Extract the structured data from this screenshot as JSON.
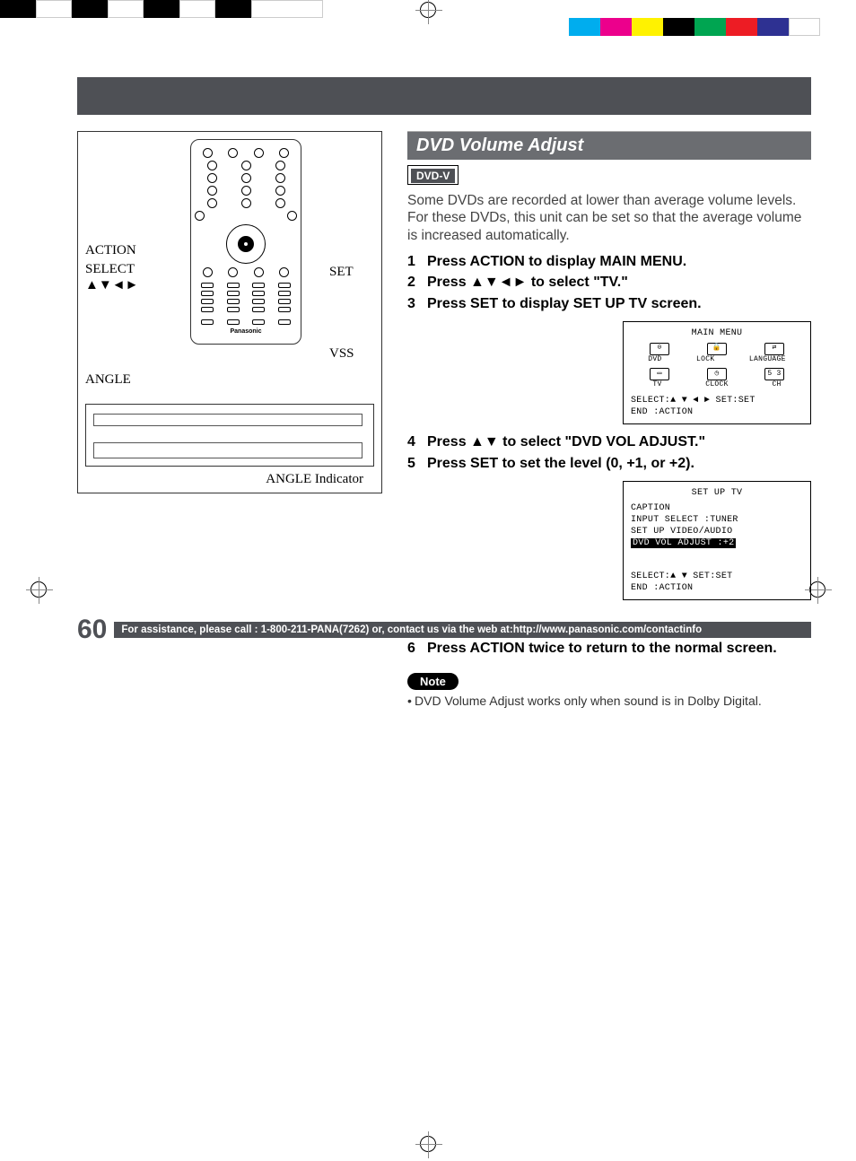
{
  "remote_labels": {
    "action": "ACTION",
    "select": "SELECT",
    "arrows": "▲▼◄►",
    "angle": "ANGLE",
    "set": "SET",
    "vss": "VSS",
    "angle_indicator": "ANGLE Indicator",
    "brand": "Panasonic"
  },
  "heading": "DVD Volume Adjust",
  "dvd_v": "DVD-V",
  "intro": "Some DVDs are recorded at lower than average volume levels. For these DVDs, this unit can be set so that the average volume is increased automatically.",
  "steps": {
    "s1": {
      "n": "1",
      "t": "Press ACTION to display MAIN MENU."
    },
    "s2": {
      "n": "2",
      "t": "Press ▲▼◄► to select \"TV.\""
    },
    "s3": {
      "n": "3",
      "t": "Press SET to display SET UP TV screen."
    },
    "s4": {
      "n": "4",
      "t": "Press ▲▼ to select \"DVD VOL ADJUST.\""
    },
    "s5": {
      "n": "5",
      "t": "Press SET to set the level (0, +1, or +2)."
    },
    "s6": {
      "n": "6",
      "t": "Press ACTION twice to return to the normal screen."
    }
  },
  "osd1": {
    "title": "MAIN MENU",
    "row1": {
      "a": "DVD",
      "b": "LOCK",
      "c": "LANGUAGE"
    },
    "row2": {
      "a": "TV",
      "b": "CLOCK",
      "c": "CH"
    },
    "foot1": "SELECT:▲ ▼ ◄ ►   SET:SET",
    "foot2": "END   :ACTION"
  },
  "osd2": {
    "title": "SET UP TV",
    "line1": "CAPTION",
    "line2": "INPUT SELECT    :TUNER",
    "line3": "SET UP VIDEO/AUDIO",
    "line4": "DVD VOL ADJUST :+2",
    "foot1": "SELECT:▲ ▼        SET:SET",
    "foot2": "END   :ACTION"
  },
  "note_label": "Note",
  "note_bullet": "•",
  "note_text": "DVD Volume Adjust works only when sound is in Dolby Digital.",
  "page_number": "60",
  "footer_text": "For assistance, please call : 1-800-211-PANA(7262) or, contact us via the web at:http://www.panasonic.com/contactinfo"
}
